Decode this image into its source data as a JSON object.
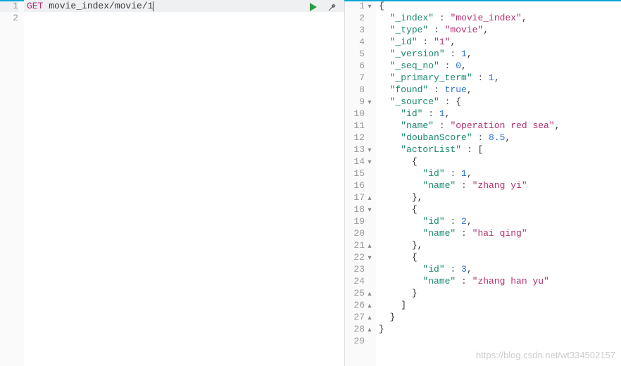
{
  "left": {
    "lines": [
      {
        "num": 1,
        "active": true,
        "tokens": [
          {
            "t": "GET",
            "c": "method"
          },
          {
            "t": " "
          },
          {
            "t": "movie_index/movie/1",
            "c": "path"
          }
        ],
        "cursor": true
      },
      {
        "num": 2
      }
    ]
  },
  "actions": {
    "play_title": "Run request",
    "wrench_title": "Options"
  },
  "right": {
    "lines": [
      {
        "num": 1,
        "fold": "▾",
        "indent": 0,
        "tokens": [
          {
            "t": "{",
            "c": "brace"
          }
        ]
      },
      {
        "num": 2,
        "indent": 1,
        "tokens": [
          {
            "t": "\"_index\"",
            "c": "key"
          },
          {
            "t": " : ",
            "c": "colon"
          },
          {
            "t": "\"movie_index\"",
            "c": "string"
          },
          {
            "t": ",",
            "c": "brace"
          }
        ]
      },
      {
        "num": 3,
        "indent": 1,
        "tokens": [
          {
            "t": "\"_type\"",
            "c": "key"
          },
          {
            "t": " : ",
            "c": "colon"
          },
          {
            "t": "\"movie\"",
            "c": "string"
          },
          {
            "t": ",",
            "c": "brace"
          }
        ]
      },
      {
        "num": 4,
        "indent": 1,
        "tokens": [
          {
            "t": "\"_id\"",
            "c": "key"
          },
          {
            "t": " : ",
            "c": "colon"
          },
          {
            "t": "\"1\"",
            "c": "string"
          },
          {
            "t": ",",
            "c": "brace"
          }
        ]
      },
      {
        "num": 5,
        "indent": 1,
        "tokens": [
          {
            "t": "\"_version\"",
            "c": "key"
          },
          {
            "t": " : ",
            "c": "colon"
          },
          {
            "t": "1",
            "c": "number"
          },
          {
            "t": ",",
            "c": "brace"
          }
        ]
      },
      {
        "num": 6,
        "indent": 1,
        "tokens": [
          {
            "t": "\"_seq_no\"",
            "c": "key"
          },
          {
            "t": " : ",
            "c": "colon"
          },
          {
            "t": "0",
            "c": "number"
          },
          {
            "t": ",",
            "c": "brace"
          }
        ]
      },
      {
        "num": 7,
        "indent": 1,
        "tokens": [
          {
            "t": "\"_primary_term\"",
            "c": "key"
          },
          {
            "t": " : ",
            "c": "colon"
          },
          {
            "t": "1",
            "c": "number"
          },
          {
            "t": ",",
            "c": "brace"
          }
        ]
      },
      {
        "num": 8,
        "indent": 1,
        "tokens": [
          {
            "t": "\"found\"",
            "c": "key"
          },
          {
            "t": " : ",
            "c": "colon"
          },
          {
            "t": "true",
            "c": "bool"
          },
          {
            "t": ",",
            "c": "brace"
          }
        ]
      },
      {
        "num": 9,
        "fold": "▾",
        "indent": 1,
        "tokens": [
          {
            "t": "\"_source\"",
            "c": "key"
          },
          {
            "t": " : ",
            "c": "colon"
          },
          {
            "t": "{",
            "c": "brace"
          }
        ]
      },
      {
        "num": 10,
        "indent": 2,
        "tokens": [
          {
            "t": "\"id\"",
            "c": "key"
          },
          {
            "t": " : ",
            "c": "colon"
          },
          {
            "t": "1",
            "c": "number"
          },
          {
            "t": ",",
            "c": "brace"
          }
        ]
      },
      {
        "num": 11,
        "indent": 2,
        "tokens": [
          {
            "t": "\"name\"",
            "c": "key"
          },
          {
            "t": " : ",
            "c": "colon"
          },
          {
            "t": "\"operation red sea\"",
            "c": "string"
          },
          {
            "t": ",",
            "c": "brace"
          }
        ]
      },
      {
        "num": 12,
        "indent": 2,
        "tokens": [
          {
            "t": "\"doubanScore\"",
            "c": "key"
          },
          {
            "t": " : ",
            "c": "colon"
          },
          {
            "t": "8.5",
            "c": "number"
          },
          {
            "t": ",",
            "c": "brace"
          }
        ]
      },
      {
        "num": 13,
        "fold": "▾",
        "indent": 2,
        "tokens": [
          {
            "t": "\"actorList\"",
            "c": "key"
          },
          {
            "t": " : ",
            "c": "colon"
          },
          {
            "t": "[",
            "c": "brace"
          }
        ]
      },
      {
        "num": 14,
        "fold": "▾",
        "indent": 3,
        "tokens": [
          {
            "t": "{",
            "c": "brace"
          }
        ]
      },
      {
        "num": 15,
        "indent": 4,
        "tokens": [
          {
            "t": "\"id\"",
            "c": "key"
          },
          {
            "t": " : ",
            "c": "colon"
          },
          {
            "t": "1",
            "c": "number"
          },
          {
            "t": ",",
            "c": "brace"
          }
        ]
      },
      {
        "num": 16,
        "indent": 4,
        "tokens": [
          {
            "t": "\"name\"",
            "c": "key"
          },
          {
            "t": " : ",
            "c": "colon"
          },
          {
            "t": "\"zhang yi\"",
            "c": "string"
          }
        ]
      },
      {
        "num": 17,
        "fold": "▴",
        "indent": 3,
        "tokens": [
          {
            "t": "},",
            "c": "brace"
          }
        ]
      },
      {
        "num": 18,
        "fold": "▾",
        "indent": 3,
        "tokens": [
          {
            "t": "{",
            "c": "brace"
          }
        ]
      },
      {
        "num": 19,
        "indent": 4,
        "tokens": [
          {
            "t": "\"id\"",
            "c": "key"
          },
          {
            "t": " : ",
            "c": "colon"
          },
          {
            "t": "2",
            "c": "number"
          },
          {
            "t": ",",
            "c": "brace"
          }
        ]
      },
      {
        "num": 20,
        "indent": 4,
        "tokens": [
          {
            "t": "\"name\"",
            "c": "key"
          },
          {
            "t": " : ",
            "c": "colon"
          },
          {
            "t": "\"hai qing\"",
            "c": "string"
          }
        ]
      },
      {
        "num": 21,
        "fold": "▴",
        "indent": 3,
        "tokens": [
          {
            "t": "},",
            "c": "brace"
          }
        ]
      },
      {
        "num": 22,
        "fold": "▾",
        "indent": 3,
        "tokens": [
          {
            "t": "{",
            "c": "brace"
          }
        ]
      },
      {
        "num": 23,
        "indent": 4,
        "tokens": [
          {
            "t": "\"id\"",
            "c": "key"
          },
          {
            "t": " : ",
            "c": "colon"
          },
          {
            "t": "3",
            "c": "number"
          },
          {
            "t": ",",
            "c": "brace"
          }
        ]
      },
      {
        "num": 24,
        "indent": 4,
        "tokens": [
          {
            "t": "\"name\"",
            "c": "key"
          },
          {
            "t": " : ",
            "c": "colon"
          },
          {
            "t": "\"zhang han yu\"",
            "c": "string"
          }
        ]
      },
      {
        "num": 25,
        "fold": "▴",
        "indent": 3,
        "tokens": [
          {
            "t": "}",
            "c": "brace"
          }
        ]
      },
      {
        "num": 26,
        "fold": "▴",
        "indent": 2,
        "tokens": [
          {
            "t": "]",
            "c": "brace"
          }
        ]
      },
      {
        "num": 27,
        "fold": "▴",
        "indent": 1,
        "tokens": [
          {
            "t": "}",
            "c": "brace"
          }
        ]
      },
      {
        "num": 28,
        "fold": "▴",
        "indent": 0,
        "tokens": [
          {
            "t": "}",
            "c": "brace"
          }
        ]
      },
      {
        "num": 29,
        "indent": 0,
        "tokens": []
      }
    ]
  },
  "watermark": "https://blog.csdn.net/wt334502157"
}
